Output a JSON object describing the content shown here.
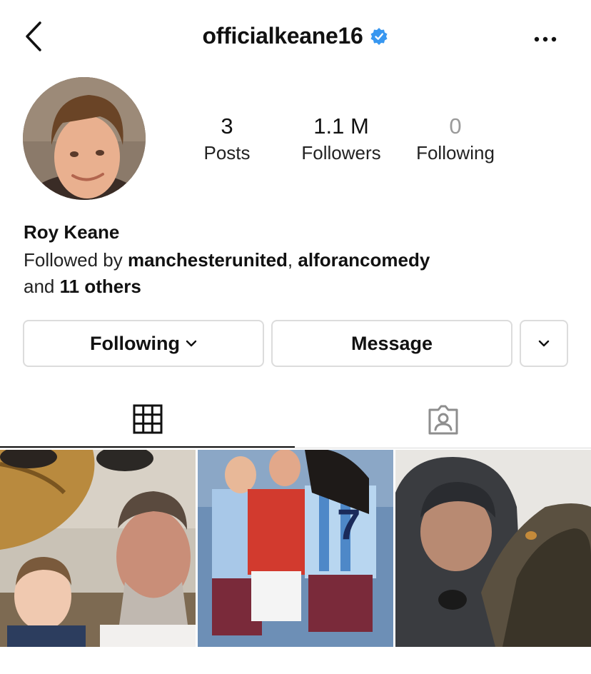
{
  "header": {
    "username": "officialkeane16",
    "verified": true,
    "back_icon": "chevron-left-icon",
    "more_icon": "ellipsis-icon",
    "verified_color": "#3897f0"
  },
  "profile": {
    "stats": [
      {
        "value": "3",
        "label": "Posts"
      },
      {
        "value": "1.1 M",
        "label": "Followers"
      },
      {
        "value": "0",
        "label": "Following"
      }
    ],
    "name": "Roy Keane",
    "followed_by_prefix": "Followed by ",
    "followed_by_user1": "manchesterunited",
    "followed_by_sep": ", ",
    "followed_by_user2": "alforancomedy",
    "followed_by_and": "and ",
    "followed_by_others": "11 others"
  },
  "actions": {
    "following_label": "Following",
    "message_label": "Message"
  },
  "tabs": [
    {
      "name": "grid",
      "icon": "grid-icon",
      "active": true
    },
    {
      "name": "tagged",
      "icon": "tagged-person-icon",
      "active": false
    }
  ],
  "posts": [
    {
      "kind": "photo",
      "subject": "selfie with child and balloon"
    },
    {
      "kind": "photo",
      "subject": "football match scuffle"
    },
    {
      "kind": "photo",
      "subject": "selfie with dog"
    }
  ]
}
